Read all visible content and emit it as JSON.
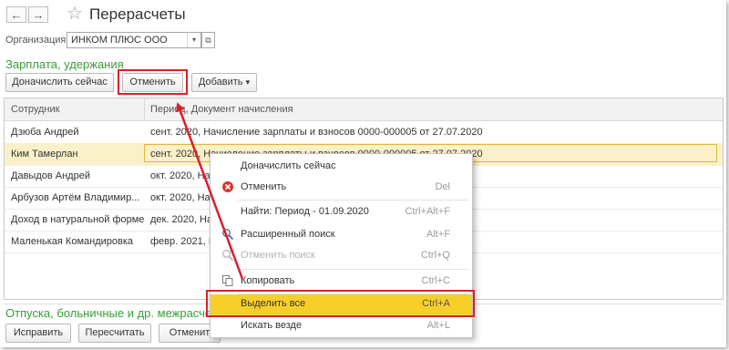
{
  "window": {
    "title": "Перерасчеты",
    "back_icon": "←",
    "forward_icon": "→",
    "favorite_icon": "☆"
  },
  "org": {
    "label": "Организация:",
    "value": "ИНКОМ ПЛЮС ООО",
    "dropdown_icon": "▾",
    "open_icon": "⧉"
  },
  "section1": {
    "title": "Зарплата, удержания"
  },
  "toolbar1": {
    "accrue_now": "Доначислить сейчас",
    "cancel": "Отменить",
    "add": "Добавить",
    "add_arrow": "▾"
  },
  "table": {
    "columns": [
      "Сотрудник",
      "Период, Документ начисления"
    ],
    "rows": [
      {
        "employee": "Дзюба Андрей",
        "document": "сент. 2020, Начисление зарплаты и взносов 0000-000005 от 27.07.2020"
      },
      {
        "employee": "Ким Тамерлан",
        "document": "сент. 2020, Начисление зарплаты и взносов 0000-000005 от 27.07.2020"
      },
      {
        "employee": "Давыдов Андрей",
        "document": "окт. 2020, Нач"
      },
      {
        "employee": "Арбузов Артём Владимир...",
        "document": "окт. 2020, Нач"
      },
      {
        "employee": "Доход в натуральной форме",
        "document": "дек. 2020, Нач"
      },
      {
        "employee": "Маленькая Командировка",
        "document": "февр. 2021, Н"
      }
    ],
    "selected_index": 1
  },
  "context_menu": {
    "items": [
      {
        "label": "Доначислить сейчас",
        "shortcut": "",
        "icon": ""
      },
      {
        "label": "Отменить",
        "shortcut": "Del",
        "icon": "cancel-icon"
      },
      {
        "label": "Найти: Период - 01.09.2020",
        "shortcut": "Ctrl+Alt+F",
        "icon": ""
      },
      {
        "label": "Расширенный поиск",
        "shortcut": "Alt+F",
        "icon": "search-icon"
      },
      {
        "label": "Отменить поиск",
        "shortcut": "Ctrl+Q",
        "icon": "clear-search-icon"
      },
      {
        "label": "Копировать",
        "shortcut": "Ctrl+C",
        "icon": "copy-icon"
      },
      {
        "label": "Выделить все",
        "shortcut": "Ctrl+A",
        "icon": ""
      },
      {
        "label": "Искать везде",
        "shortcut": "Alt+L",
        "icon": ""
      }
    ],
    "highlighted_index": 6,
    "disabled_index": 4
  },
  "section2": {
    "title": "Отпуска, больничные и др. межрасчет"
  },
  "toolbar2": {
    "fix": "Исправить",
    "recalculate": "Пересчитать",
    "cancel": "Отменит"
  },
  "colors": {
    "accent_green": "#3a9c3a",
    "highlight_yellow": "#f8cf28",
    "annotation_red": "#d9202a",
    "selected_row": "#fbf1c9"
  }
}
